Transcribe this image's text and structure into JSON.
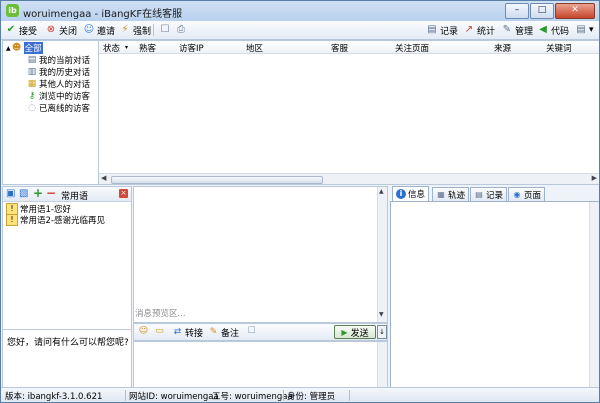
{
  "window": {
    "app_badge": "ib",
    "title": "woruimengaa - iBangKF在线客服",
    "controls": {
      "minimize": "–",
      "maximize": "□",
      "close": "✕"
    }
  },
  "toolbar": {
    "left": [
      {
        "label": "接受",
        "icon": "check-icon",
        "glyph": "✔",
        "color": "#2a9a2a"
      },
      {
        "label": "关闭",
        "icon": "close-circle-icon",
        "glyph": "⊗",
        "color": "#d23a2a"
      },
      {
        "label": "邀请",
        "icon": "invite-icon",
        "glyph": "☺",
        "color": "#3a7fd0"
      },
      {
        "label": "强制",
        "icon": "force-icon",
        "glyph": "⚡",
        "color": "#d08a1a"
      }
    ],
    "extra_icons": [
      {
        "icon": "speech-bubble-icon",
        "glyph": "☐"
      },
      {
        "icon": "print-icon",
        "glyph": "⎙"
      }
    ],
    "right": [
      {
        "label": "记录",
        "icon": "record-icon",
        "glyph": "▤",
        "color": "#5a6f8a"
      },
      {
        "label": "统计",
        "icon": "chart-icon",
        "glyph": "↗",
        "color": "#c0392b"
      },
      {
        "label": "管理",
        "icon": "wrench-icon",
        "glyph": "✎",
        "color": "#5a6f8a"
      },
      {
        "label": "代码",
        "icon": "code-icon",
        "glyph": "◀",
        "color": "#2a9a2a"
      }
    ],
    "more": "▾"
  },
  "tree": {
    "root": {
      "label": "全部",
      "icon": "person-icon",
      "glyph": "☻",
      "expander": "▲"
    },
    "items": [
      {
        "label": "我的当前对话",
        "icon": "doc-icon",
        "glyph": "▤"
      },
      {
        "label": "我的历史对话",
        "icon": "history-icon",
        "glyph": "▥"
      },
      {
        "label": "其他人的对话",
        "icon": "folder-icon",
        "glyph": "▦"
      },
      {
        "label": "浏览中的访客",
        "icon": "key-icon",
        "glyph": "⚷"
      },
      {
        "label": "已离线的访客",
        "icon": "offline-icon",
        "glyph": "◌"
      }
    ]
  },
  "grid": {
    "columns": [
      "状态",
      "▾",
      "熟客",
      "访客IP",
      "地区",
      "客服",
      "关注页面",
      "来源",
      "关键词"
    ],
    "scroll_left": "◀",
    "scroll_right": "▶"
  },
  "phrases": {
    "title": "常用语",
    "toolbar_icons": [
      {
        "icon": "book-icon",
        "glyph": "▣",
        "color": "#2a6fd0"
      },
      {
        "icon": "edit-icon",
        "glyph": "▧",
        "color": "#2a6fd0"
      },
      {
        "icon": "add-icon",
        "glyph": "+",
        "color": "#2a9a2a"
      },
      {
        "icon": "remove-icon",
        "glyph": "−",
        "color": "#d23a2a"
      }
    ],
    "close": "×",
    "items": [
      "常用语1-您好",
      "常用语2-感谢光临再见"
    ],
    "item_glyph": "!"
  },
  "left_message": "您好，请问有什么可以帮您呢?",
  "chat": {
    "preview_placeholder": "消息预览区...",
    "scroll_up": "▲",
    "scroll_down": "▼",
    "tools": [
      {
        "icon": "emoticon-icon",
        "glyph": "☺",
        "label": ""
      },
      {
        "icon": "folder-open-icon",
        "glyph": "▭",
        "label": ""
      },
      {
        "icon": "transfer-icon",
        "glyph": "⇄",
        "label": "转接"
      },
      {
        "icon": "note-icon",
        "glyph": "✎",
        "label": "备注"
      },
      {
        "icon": "comment-icon",
        "glyph": "☐",
        "label": ""
      }
    ],
    "send_label": "发送",
    "send_glyph": "▶",
    "send_dropdown": "↓"
  },
  "right_tabs": [
    {
      "label": "信息",
      "icon": "info-icon",
      "glyph": "i",
      "active": true
    },
    {
      "label": "轨迹",
      "icon": "track-icon",
      "glyph": "▦",
      "active": false
    },
    {
      "label": "记录",
      "icon": "record-tab-icon",
      "glyph": "▤",
      "active": false
    },
    {
      "label": "页面",
      "icon": "page-icon",
      "glyph": "◉",
      "active": false
    }
  ],
  "status": {
    "version": "版本: ibangkf-3.1.0.621",
    "site_id": "网站ID: woruimengaa",
    "job_no": "工号: woruimengaa",
    "role": "身份: 管理员"
  }
}
